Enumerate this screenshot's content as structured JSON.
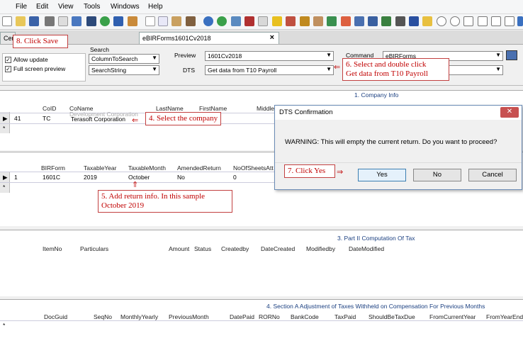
{
  "menu": [
    "File",
    "Edit",
    "View",
    "Tools",
    "Windows",
    "Help"
  ],
  "tabs": [
    {
      "label": "Centr"
    },
    {
      "label": "eBIRForms1601Cv2018"
    }
  ],
  "tab_close_glyph": "×",
  "params": {
    "allow_update_label": "Allow update",
    "full_screen_label": "Full screen preview",
    "search_label": "Search",
    "search_field_value": "ColumnToSearch",
    "search_string_value": "SearchString",
    "preview_label": "Preview",
    "preview_value": "1601Cv2018",
    "dts_label": "DTS",
    "dts_value": "Get data from T10 Payroll",
    "command_label": "Command",
    "command_value": "eBIRForms"
  },
  "section1": {
    "title": "1. Company Info",
    "headers": [
      "CoID",
      "CoName",
      "LastName",
      "FirstName",
      "Middle"
    ],
    "row": {
      "num": "41",
      "coid": "TC",
      "coname": "Terasoft Corporation",
      "faded": "Development Corporation"
    }
  },
  "section2": {
    "headers": [
      "BIRForm",
      "TaxableYear",
      "TaxableMonth",
      "AmendedReturn",
      "NoOfSheetsAtt"
    ],
    "row": {
      "num": "1",
      "birform": "1601C",
      "year": "2019",
      "month": "October",
      "amended": "No",
      "sheets": "0"
    }
  },
  "section3": {
    "title": "3. Part II Computation Of Tax",
    "headers": [
      "ItemNo",
      "Particulars",
      "Amount",
      "Status",
      "Createdby",
      "DateCreated",
      "Modifiedby",
      "DateModified"
    ]
  },
  "section4": {
    "title": "4. Section A Adjustment of Taxes Withheld on Compensation For Previous Months",
    "headers": [
      "DocGuid",
      "SeqNo",
      "MonthlyYearly",
      "PreviousMonth",
      "DatePaid",
      "RORNo",
      "BankCode",
      "TaxPaid",
      "ShouldBeTaxDue",
      "FromCurrentYear",
      "FromYearEnd"
    ]
  },
  "dialog": {
    "title": "DTS Confirmation",
    "message": "WARNING: This will empty the current return. Do you want to proceed?",
    "yes": "Yes",
    "no": "No",
    "cancel": "Cancel"
  },
  "callouts": {
    "c8": "8. Click Save",
    "c4": "4. Select the company",
    "c6_line1": "6. Select and double click",
    "c6_line2": "Get data from T10 Payroll",
    "c7": "7. Click Yes",
    "c5_line1": "5. Add return info. In this sample",
    "c5_line2": "October 2019"
  },
  "colors": {
    "callout": "#c00000",
    "section_title": "#1a3f80"
  }
}
